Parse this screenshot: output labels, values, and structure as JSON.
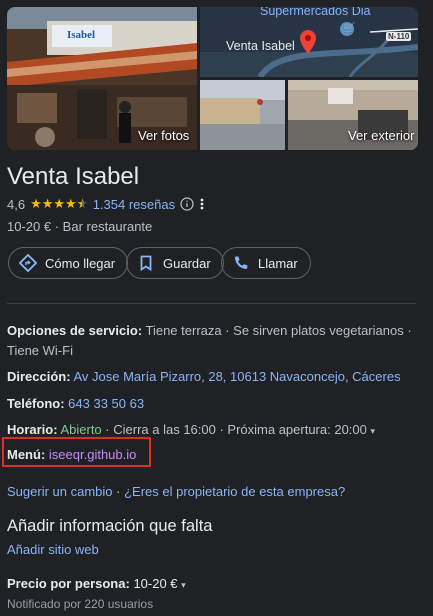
{
  "photos": {
    "main_label": "Ver fotos",
    "exterior_label": "Ver exterior",
    "map": {
      "poi": "Supermercados Dia",
      "place": "Venta Isabel",
      "road": "N-110"
    },
    "sign_text": "Isabel"
  },
  "place": {
    "name": "Venta Isabel",
    "rating": "4,6",
    "reviews": "1.354 reseñas",
    "price": "10-20 €",
    "category": "Bar restaurante"
  },
  "actions": [
    {
      "label": "Cómo llegar",
      "icon": "directions-icon"
    },
    {
      "label": "Guardar",
      "icon": "bookmark-icon"
    },
    {
      "label": "Llamar",
      "icon": "phone-icon"
    }
  ],
  "info": {
    "services_label": "Opciones de servicio:",
    "services_value": "Tiene terraza · Se sirven platos vegetarianos · Tiene Wi-Fi",
    "address_label": "Dirección:",
    "address_value": "Av Jose María Pizarro, 28, 10613 Navaconcejo, Cáceres",
    "phone_label": "Teléfono:",
    "phone_value": "643 33 50 63",
    "hours_label": "Horario:",
    "hours_status": "Abierto",
    "hours_detail": "· Cierra a las 16:00 · Próxima apertura: 20:00",
    "menu_label": "Menú:",
    "menu_value": "iseeqr.github.io",
    "suggest": "Sugerir un cambio",
    "owner": "¿Eres el propietario de esta empresa?"
  },
  "missing": {
    "title": "Añadir información que falta",
    "add_website": "Añadir sitio web"
  },
  "price_per_person": {
    "label": "Precio por persona:",
    "value": "10-20 €",
    "note": "Notificado por 220 usuarios"
  },
  "colors": {
    "background": "#202124",
    "link": "#8ab4f8",
    "open": "#81c995",
    "star": "#fbbc04",
    "highlight_box": "#d93025",
    "visited_link": "#c58af9"
  }
}
